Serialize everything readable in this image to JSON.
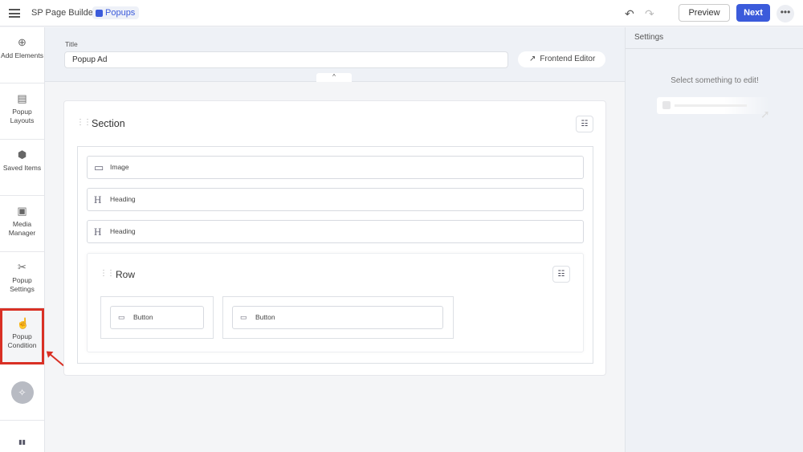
{
  "topbar": {
    "app_name": "SP Page Builder",
    "badge": "Popups",
    "preview": "Preview",
    "next": "Next",
    "more": "•••",
    "undo": "↶",
    "redo": "↷",
    "accent": "#3b5bdb"
  },
  "sidebar": {
    "items": [
      {
        "label": "Add Elements",
        "icon": "⊕"
      },
      {
        "label": "Popup Layouts",
        "icon": "▤"
      },
      {
        "label": "Saved Items",
        "icon": "⬢"
      },
      {
        "label": "Media Manager",
        "icon": "▣"
      },
      {
        "label": "Popup Settings",
        "icon": "✂"
      },
      {
        "label": "Popup Condition",
        "icon": "☝"
      }
    ],
    "clean_icon": "✧",
    "bottom_icon": "▮▮"
  },
  "header": {
    "title_label": "Title",
    "title_value": "Popup Ad",
    "frontend_editor": "Frontend Editor",
    "collapse": "^"
  },
  "canvas": {
    "section_title": "Section",
    "elements": [
      {
        "label": "Image",
        "icon": "▭"
      },
      {
        "label": "Heading",
        "icon": "H"
      },
      {
        "label": "Heading",
        "icon": "H"
      }
    ],
    "row_title": "Row",
    "buttons": [
      {
        "label": "Button"
      },
      {
        "label": "Button"
      }
    ]
  },
  "settings": {
    "title": "Settings",
    "empty": "Select something to edit!"
  }
}
